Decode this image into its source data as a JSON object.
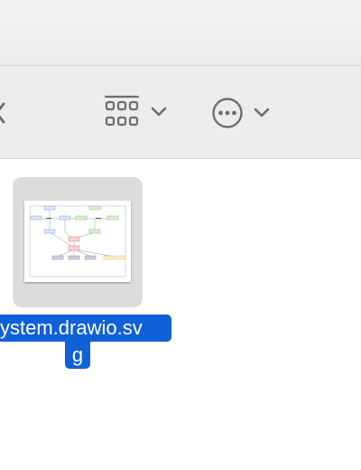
{
  "toolbar": {
    "group_button_icon": "grid-view-icon",
    "group_dropdown_icon": "chevron-down-icon",
    "more_button_icon": "ellipsis-circle-icon",
    "more_dropdown_icon": "chevron-down-icon",
    "back_icon": "chevron-left-icon"
  },
  "file": {
    "name_line1": "ystem.drawio.sv",
    "name_line2": "g",
    "selected": true,
    "selection_color": "#1060d8"
  },
  "colors": {
    "toolbar_bg": "#ececec",
    "icon_gray": "#6e6e6e",
    "thumb_bg": "#dcdcdc",
    "accent": "#1060d8"
  }
}
